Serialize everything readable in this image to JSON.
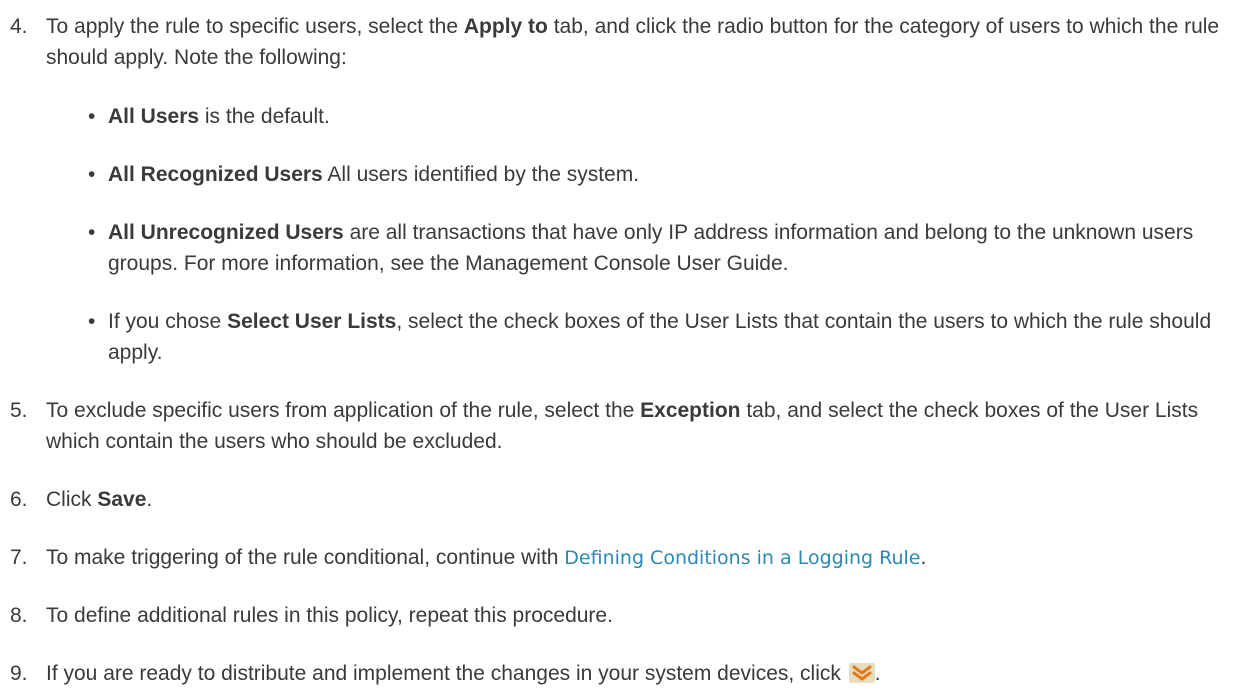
{
  "steps": [
    {
      "num": "4.",
      "parts": [
        "To apply the rule to specific users, select the ",
        "Apply to",
        " tab, and click the radio button for the category of users to which the rule should apply. Note the following:"
      ],
      "bullets": [
        {
          "bold": "All Users",
          "rest": " is the default."
        },
        {
          "bold": "All Recognized Users",
          "rest": " All users identified by the system."
        },
        {
          "bold": "All Unrecognized Users",
          "rest": " are all transactions that have only IP address information and belong to the unknown users groups. For more information, see the Management Console User Guide."
        },
        {
          "pre": "If you chose ",
          "bold": "Select User Lists",
          "rest": ", select the check boxes of the User Lists that contain the users to which the rule should apply."
        }
      ]
    },
    {
      "num": "5.",
      "parts": [
        "To exclude specific users from application of the rule, select the ",
        "Exception",
        " tab, and select the check boxes of the User Lists which contain the users who should be excluded."
      ]
    },
    {
      "num": "6.",
      "parts": [
        "Click ",
        "Save",
        "."
      ]
    },
    {
      "num": "7.",
      "pre": "To make triggering of the rule conditional, continue with ",
      "link": "Defining Conditions in a Logging Rule",
      "post": "."
    },
    {
      "num": "8.",
      "text": "To define additional rules in this policy, repeat this procedure."
    },
    {
      "num": "9.",
      "pre": "If you are ready to distribute and implement the changes in your system devices, click ",
      "post": "."
    }
  ],
  "colors": {
    "text": "#3a3a3a",
    "link": "#2a8ab3",
    "icon_bg": "#e8dcc0",
    "icon_chevron": "#e07a1a"
  },
  "icons": {
    "deploy": "double-chevron-down-icon"
  }
}
